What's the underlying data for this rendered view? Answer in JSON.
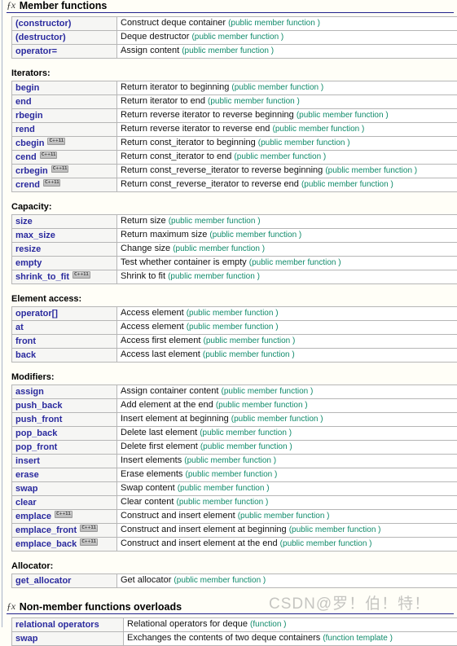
{
  "page": {
    "watermark": "CSDN@罗！伯！特！",
    "fx_icon_glyph": "ƒx"
  },
  "member_section": {
    "title": "Member functions",
    "groups": [
      {
        "label": "",
        "rows": [
          {
            "name": "(constructor)",
            "cpp11": false,
            "desc": "Construct deque container",
            "tag": "(public member function )"
          },
          {
            "name": "(destructor)",
            "cpp11": false,
            "desc": "Deque destructor",
            "tag": "(public member function )"
          },
          {
            "name": "operator=",
            "cpp11": false,
            "desc": "Assign content",
            "tag": "(public member function )"
          }
        ]
      },
      {
        "label": "Iterators:",
        "rows": [
          {
            "name": "begin",
            "cpp11": false,
            "desc": "Return iterator to beginning",
            "tag": "(public member function )"
          },
          {
            "name": "end",
            "cpp11": false,
            "desc": "Return iterator to end",
            "tag": "(public member function )"
          },
          {
            "name": "rbegin",
            "cpp11": false,
            "desc": "Return reverse iterator to reverse beginning",
            "tag": "(public member function )"
          },
          {
            "name": "rend",
            "cpp11": false,
            "desc": "Return reverse iterator to reverse end",
            "tag": "(public member function )"
          },
          {
            "name": "cbegin",
            "cpp11": true,
            "desc": "Return const_iterator to beginning",
            "tag": "(public member function )"
          },
          {
            "name": "cend",
            "cpp11": true,
            "desc": "Return const_iterator to end",
            "tag": "(public member function )"
          },
          {
            "name": "crbegin",
            "cpp11": true,
            "desc": "Return const_reverse_iterator to reverse beginning",
            "tag": "(public member function )"
          },
          {
            "name": "crend",
            "cpp11": true,
            "desc": "Return const_reverse_iterator to reverse end",
            "tag": "(public member function )"
          }
        ]
      },
      {
        "label": "Capacity:",
        "rows": [
          {
            "name": "size",
            "cpp11": false,
            "desc": "Return size",
            "tag": "(public member function )"
          },
          {
            "name": "max_size",
            "cpp11": false,
            "desc": "Return maximum size",
            "tag": "(public member function )"
          },
          {
            "name": "resize",
            "cpp11": false,
            "desc": "Change size",
            "tag": "(public member function )"
          },
          {
            "name": "empty",
            "cpp11": false,
            "desc": "Test whether container is empty",
            "tag": "(public member function )"
          },
          {
            "name": "shrink_to_fit",
            "cpp11": true,
            "desc": "Shrink to fit",
            "tag": "(public member function )"
          }
        ]
      },
      {
        "label": "Element access:",
        "rows": [
          {
            "name": "operator[]",
            "cpp11": false,
            "desc": "Access element",
            "tag": "(public member function )"
          },
          {
            "name": "at",
            "cpp11": false,
            "desc": "Access element",
            "tag": "(public member function )"
          },
          {
            "name": "front",
            "cpp11": false,
            "desc": "Access first element",
            "tag": "(public member function )"
          },
          {
            "name": "back",
            "cpp11": false,
            "desc": "Access last element",
            "tag": "(public member function )"
          }
        ]
      },
      {
        "label": "Modifiers:",
        "rows": [
          {
            "name": "assign",
            "cpp11": false,
            "desc": "Assign container content",
            "tag": "(public member function )"
          },
          {
            "name": "push_back",
            "cpp11": false,
            "desc": "Add element at the end",
            "tag": "(public member function )"
          },
          {
            "name": "push_front",
            "cpp11": false,
            "desc": "Insert element at beginning",
            "tag": "(public member function )"
          },
          {
            "name": "pop_back",
            "cpp11": false,
            "desc": "Delete last element",
            "tag": "(public member function )"
          },
          {
            "name": "pop_front",
            "cpp11": false,
            "desc": "Delete first element",
            "tag": "(public member function )"
          },
          {
            "name": "insert",
            "cpp11": false,
            "desc": "Insert elements",
            "tag": "(public member function )"
          },
          {
            "name": "erase",
            "cpp11": false,
            "desc": "Erase elements",
            "tag": "(public member function )"
          },
          {
            "name": "swap",
            "cpp11": false,
            "desc": "Swap content",
            "tag": "(public member function )"
          },
          {
            "name": "clear",
            "cpp11": false,
            "desc": "Clear content",
            "tag": "(public member function )"
          },
          {
            "name": "emplace",
            "cpp11": true,
            "desc": "Construct and insert element",
            "tag": "(public member function )"
          },
          {
            "name": "emplace_front",
            "cpp11": true,
            "desc": "Construct and insert element at beginning",
            "tag": "(public member function )"
          },
          {
            "name": "emplace_back",
            "cpp11": true,
            "desc": "Construct and insert element at the end",
            "tag": "(public member function )"
          }
        ]
      },
      {
        "label": "Allocator:",
        "rows": [
          {
            "name": "get_allocator",
            "cpp11": false,
            "desc": "Get allocator",
            "tag": "(public member function )"
          }
        ]
      }
    ]
  },
  "nonmember_section": {
    "title": "Non-member functions overloads",
    "rows": [
      {
        "name": "relational operators",
        "cpp11": false,
        "desc": "Relational operators for deque",
        "tag": "(function )"
      },
      {
        "name": "swap",
        "cpp11": false,
        "desc": "Exchanges the contents of two deque containers",
        "tag": "(function template )"
      }
    ]
  },
  "cpp11_badge_label": "C++11"
}
